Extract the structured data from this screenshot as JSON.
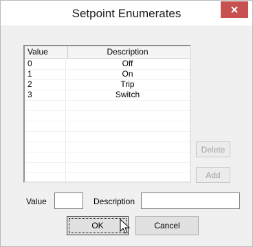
{
  "window": {
    "title": "Setpoint Enumerates"
  },
  "list": {
    "columns": {
      "value": "Value",
      "description": "Description"
    },
    "rows": [
      {
        "value": "0",
        "description": "Off"
      },
      {
        "value": "1",
        "description": "On"
      },
      {
        "value": "2",
        "description": "Trip"
      },
      {
        "value": "3",
        "description": "Switch"
      }
    ]
  },
  "buttons": {
    "delete": "Delete",
    "add": "Add",
    "ok": "OK",
    "cancel": "Cancel"
  },
  "form": {
    "value_label": "Value",
    "value_input": "",
    "description_label": "Description",
    "description_input": ""
  },
  "icons": {
    "close": "close-icon",
    "cursor": "mouse-cursor-icon"
  },
  "colors": {
    "close_button": "#c75050",
    "dialog_bg": "#f0f0f0"
  }
}
